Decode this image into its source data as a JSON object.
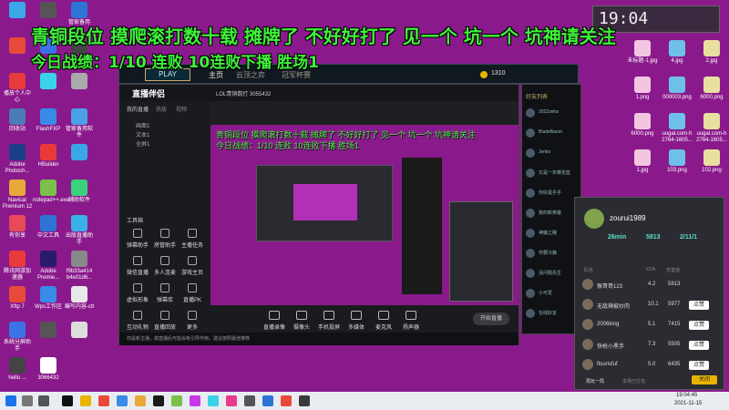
{
  "overlay": {
    "title": "青铜段位  摸爬滚打数十载 摊牌了 不好好打了  见一个  坑一个  坑神请关注",
    "subtitle": "今日战绩：1/10  连败  10连败下播  胜场1"
  },
  "desktop_left": [
    {
      "label": "",
      "color": "#3aa7e8"
    },
    {
      "label": "",
      "color": "#555"
    },
    {
      "label": "管家备用",
      "color": "#2e74d6"
    },
    {
      "label": "",
      "color": "#e84a3a"
    },
    {
      "label": "",
      "color": "#3a73e8"
    },
    {
      "label": "",
      "color": "#444"
    },
    {
      "label": "播放个人中心",
      "color": "#e83a3a"
    },
    {
      "label": "",
      "color": "#3ad2e8"
    },
    {
      "label": "",
      "color": "#aaa"
    },
    {
      "label": "回收站",
      "color": "#4b7bb8"
    },
    {
      "label": "FlashFXP",
      "color": "#3a8ae8"
    },
    {
      "label": "管家备用软件",
      "color": "#4ba0e8"
    },
    {
      "label": "Adobe Photosh...",
      "color": "#1c3f8a"
    },
    {
      "label": "HBuilder",
      "color": "#e83a3a"
    },
    {
      "label": "",
      "color": "#3aa7e8"
    },
    {
      "label": "Navicat Premium 12",
      "color": "#e8a83a"
    },
    {
      "label": "notepad++.exe",
      "color": "#7cc04a"
    },
    {
      "label": "辅助软件",
      "color": "#3ad27c"
    },
    {
      "label": "有你享",
      "color": "#e84a5a"
    },
    {
      "label": "中文工具",
      "color": "#2e74d6"
    },
    {
      "label": "出版直播助手",
      "color": "#3ab2e8"
    },
    {
      "label": "腾讯网游加速器",
      "color": "#e83a3a"
    },
    {
      "label": "Adobe Premie...",
      "color": "#2a1a6a"
    },
    {
      "label": "f9b33a414 b4e01d6...",
      "color": "#888"
    },
    {
      "label": "Xftp 7",
      "color": "#e84a3a"
    },
    {
      "label": "Wps工作区",
      "color": "#3a8ae8"
    },
    {
      "label": "编写内容-ctt",
      "color": "#e8e8e8"
    },
    {
      "label": "系统分屏助手",
      "color": "#3a73e8"
    },
    {
      "label": "",
      "color": "#555"
    },
    {
      "label": "",
      "color": "#ddd"
    },
    {
      "label": "hello ...",
      "color": "#444"
    },
    {
      "label": "3066432",
      "color": "#fff"
    }
  ],
  "game_client": {
    "play": "PLAY",
    "tabs": [
      "主页",
      "云顶之弈",
      "冠军杯赛"
    ],
    "coins": "1310"
  },
  "stream_app": {
    "logo": "直播伴侣",
    "title": "LOL青铜数打 3055432",
    "left_items": [
      "画面1",
      "文本1",
      "全屏1"
    ],
    "left_tabs": [
      "我的直播",
      "热版",
      "视频"
    ],
    "tools_label": "工具箱",
    "tools": [
      "弹幕助手",
      "房管助手",
      "主播任务",
      "微信直播",
      "多人连麦",
      "游戏主页",
      "虚拟形象",
      "弹幕库",
      "直播PK",
      "互动礼物",
      "直播回放",
      "更多"
    ],
    "bottom_tools": [
      "直播录像",
      "摄像头",
      "手机投屏",
      "多媒体",
      "麦克风",
      "扬声器"
    ],
    "start_button": "开始直播",
    "hint": "你是新主播，做直播后可能会有引导作用，建议按照最佳推荐"
  },
  "friends_panel": {
    "title": "好友列表",
    "friends": [
      "2022zeha",
      "BladeBaron",
      "Jenko",
      "又是一年樱花蓝",
      "你好黑乎乎",
      "我的新英雄",
      "神魔之瞳",
      "你要冷静",
      "没问题先生",
      "小可爱",
      "在线好友"
    ]
  },
  "player_card": {
    "name": "zourui1989",
    "stats_labels": [
      "26min",
      "5813",
      "2/11/1"
    ],
    "header": [
      "队名",
      "KDA",
      "伤害值"
    ],
    "rows": [
      {
        "name": "猴哥哥123",
        "kda": "4.2",
        "dmg": "5813",
        "btn": ""
      },
      {
        "name": "无敌辣椒炒肉",
        "kda": "10.1",
        "dmg": "5977",
        "btn": "点赞"
      },
      {
        "name": "2006king",
        "kda": "5.1",
        "dmg": "7415",
        "btn": "点赞"
      },
      {
        "name": "快枪小黑手",
        "kda": "7.3",
        "dmg": "5505",
        "btn": "点赞"
      },
      {
        "name": "flourisfuf",
        "kda": "5.0",
        "dmg": "6435",
        "btn": "点赞"
      }
    ],
    "bottom_left": "再玩一局",
    "bottom_mid": "本场已打完",
    "close": "关闭"
  },
  "right_desktop": {
    "clock": "19:04",
    "files": [
      "未标题-1.jpg",
      "4.jpg",
      "2.jpg",
      "1.png",
      "000003.png",
      "6000.png",
      "6000.png",
      "uugal.com-h 2764-1605...",
      "uugal.com-h 2764-1605...",
      "1.jpg",
      "103.png",
      "102.png"
    ]
  },
  "taskbar": {
    "time": "19:04:45",
    "date": "2021-11-15"
  },
  "colors": {
    "desktop": "#8a1a8c",
    "overlay_text": "#3ff23a",
    "accent_gold": "#e8b400"
  }
}
